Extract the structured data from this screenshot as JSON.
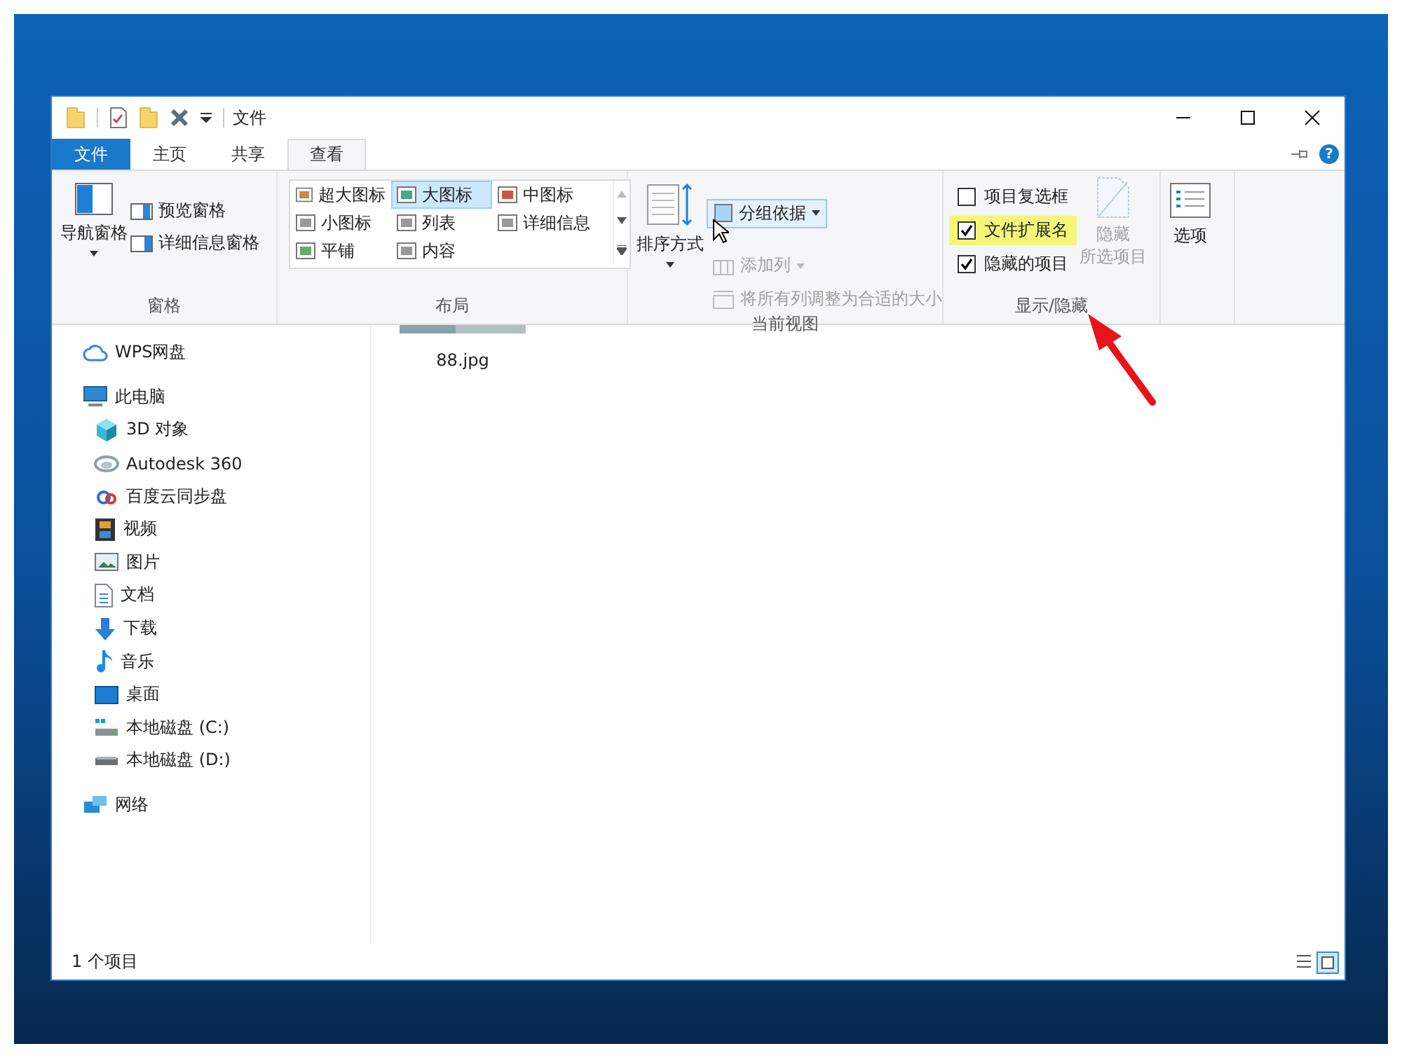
{
  "window": {
    "title": "文件",
    "help": "?"
  },
  "ribbon_tabs": [
    {
      "label": "文件",
      "selected": false,
      "kind": "file"
    },
    {
      "label": "主页",
      "selected": false,
      "kind": "tab"
    },
    {
      "label": "共享",
      "selected": false,
      "kind": "tab"
    },
    {
      "label": "查看",
      "selected": true,
      "kind": "tab"
    }
  ],
  "panes_group": {
    "label": "窗格",
    "nav_pane": "导航窗格",
    "items": [
      {
        "label": "预览窗格",
        "kind": "preview"
      },
      {
        "label": "详细信息窗格",
        "kind": "details"
      }
    ]
  },
  "layout_group": {
    "label": "布局",
    "options": [
      {
        "label": "超大图标",
        "selected": false,
        "kind": "xl"
      },
      {
        "label": "大图标",
        "selected": true,
        "kind": "large"
      },
      {
        "label": "中图标",
        "selected": false,
        "kind": "medium"
      },
      {
        "label": "小图标",
        "selected": false,
        "kind": "small"
      },
      {
        "label": "列表",
        "selected": false,
        "kind": "list"
      },
      {
        "label": "详细信息",
        "selected": false,
        "kind": "details"
      },
      {
        "label": "平铺",
        "selected": false,
        "kind": "tiles"
      },
      {
        "label": "内容",
        "selected": false,
        "kind": "content"
      }
    ]
  },
  "current_view_group": {
    "label": "当前视图",
    "sort": "排序方式",
    "group_by": "分组依据",
    "add_column": {
      "label": "添加列",
      "disabled": true
    },
    "fit_columns": {
      "label": "将所有列调整为合适的大小",
      "disabled": true
    }
  },
  "show_hide_group": {
    "label": "显示/隐藏",
    "checkboxes": [
      {
        "label": "项目复选框",
        "checked": false,
        "highlighted": false
      },
      {
        "label": "文件扩展名",
        "checked": true,
        "highlighted": true
      },
      {
        "label": "隐藏的项目",
        "checked": true,
        "highlighted": false
      }
    ],
    "hide_selected": {
      "lines": [
        "隐藏",
        "所选项目"
      ],
      "disabled": true
    }
  },
  "options_button": "选项",
  "sidebar": {
    "items": [
      {
        "label": "WPS网盘",
        "kind": "cloud"
      },
      {
        "label": "此电脑",
        "kind": "computer",
        "children": [
          {
            "label": "3D 对象",
            "kind": "cube"
          },
          {
            "label": "Autodesk 360",
            "kind": "autodesk"
          },
          {
            "label": "百度云同步盘",
            "kind": "baidu"
          },
          {
            "label": "视频",
            "kind": "video"
          },
          {
            "label": "图片",
            "kind": "pictures"
          },
          {
            "label": "文档",
            "kind": "documents"
          },
          {
            "label": "下载",
            "kind": "download"
          },
          {
            "label": "音乐",
            "kind": "music"
          },
          {
            "label": "桌面",
            "kind": "desktop"
          },
          {
            "label": "本地磁盘 (C:)",
            "kind": "systemdrive"
          },
          {
            "label": "本地磁盘 (D:)",
            "kind": "drive"
          }
        ]
      },
      {
        "label": "网络",
        "kind": "network"
      }
    ]
  },
  "files": [
    {
      "name": "88.jpg",
      "kind": "picture"
    }
  ],
  "status_bar": {
    "count": "1 个项目"
  }
}
